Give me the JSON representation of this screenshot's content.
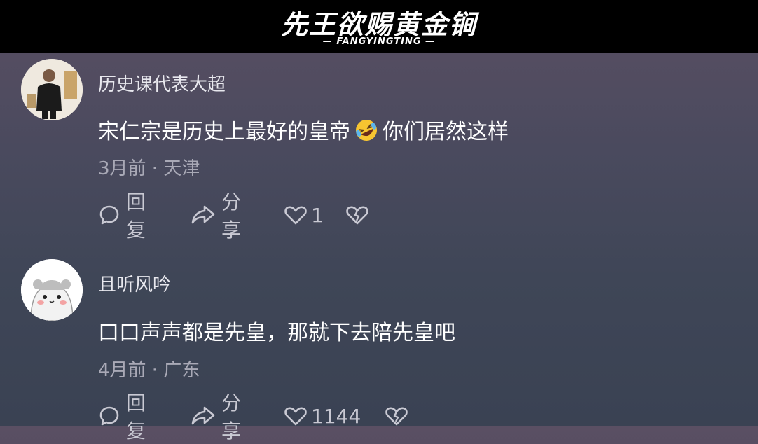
{
  "header": {
    "title": "先王欲赐黄金锏",
    "subtitle": "— FANGYINGTING —"
  },
  "comments": [
    {
      "username": "历史课代表大超",
      "text_before": "宋仁宗是历史上最好的皇帝",
      "emoji": "rolling-on-floor-laughing-emoji",
      "text_after": "你们居然这样",
      "meta": "3月前 · 天津",
      "reply_label": "回复",
      "share_label": "分享",
      "like_count": "1",
      "avatar": "person-photo-avatar"
    },
    {
      "username": "且听风吟",
      "text": "口口声声都是先皇，那就下去陪先皇吧",
      "meta": "4月前 · 广东",
      "reply_label": "回复",
      "share_label": "分享",
      "like_count": "1144",
      "avatar": "hamster-cartoon-avatar"
    }
  ],
  "colors": {
    "header_bg": "#000000",
    "text": "#ffffff",
    "meta": "#a9a9b6",
    "action": "#c9c9d3"
  }
}
